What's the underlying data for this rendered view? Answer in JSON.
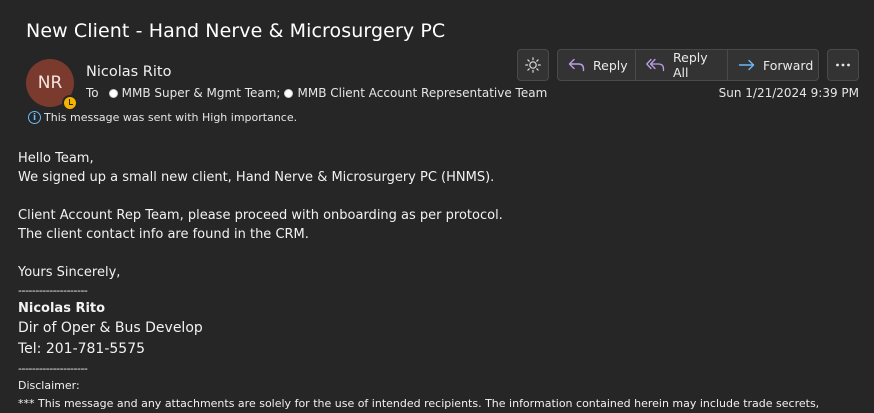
{
  "message": {
    "subject": "New Client - Hand Nerve & Microsurgery PC",
    "sender": {
      "initials": "NR",
      "name": "Nicolas Rito",
      "avatar_color": "#7a3b2e",
      "presence_color": "#f4b400"
    },
    "to_label": "To",
    "recipients": [
      "MMB Super & Mgmt Team;",
      "MMB Client Account Representative Team"
    ],
    "importance_notice": "This message was sent with High importance.",
    "timestamp": "Sun 1/21/2024 9:39 PM"
  },
  "toolbar": {
    "theme_icon": "sun-icon",
    "reply_label": "Reply",
    "reply_all_label": "Reply All",
    "forward_label": "Forward",
    "more_icon": "more-horizontal-icon",
    "accent_purple": "#b9a0e6",
    "accent_blue": "#6cb8f6"
  },
  "body": {
    "greeting": "Hello Team,",
    "line1": "We signed up a small new client, Hand Nerve & Microsurgery PC (HNMS).",
    "line2": "Client Account Rep Team, please proceed with onboarding as per protocol.",
    "line3": "The client contact info are found in the CRM.",
    "closing": "Yours Sincerely,",
    "separator": "--------------------",
    "signature_name": "Nicolas Rito",
    "signature_title": "Dir of Oper & Bus Develop",
    "signature_tel": "Tel: 201-781-5575",
    "disclaimer_label": "Disclaimer:",
    "disclaimer_cutoff": "*** This message and any attachments are solely for the use of intended recipients. The information contained herein may include trade secrets,"
  }
}
